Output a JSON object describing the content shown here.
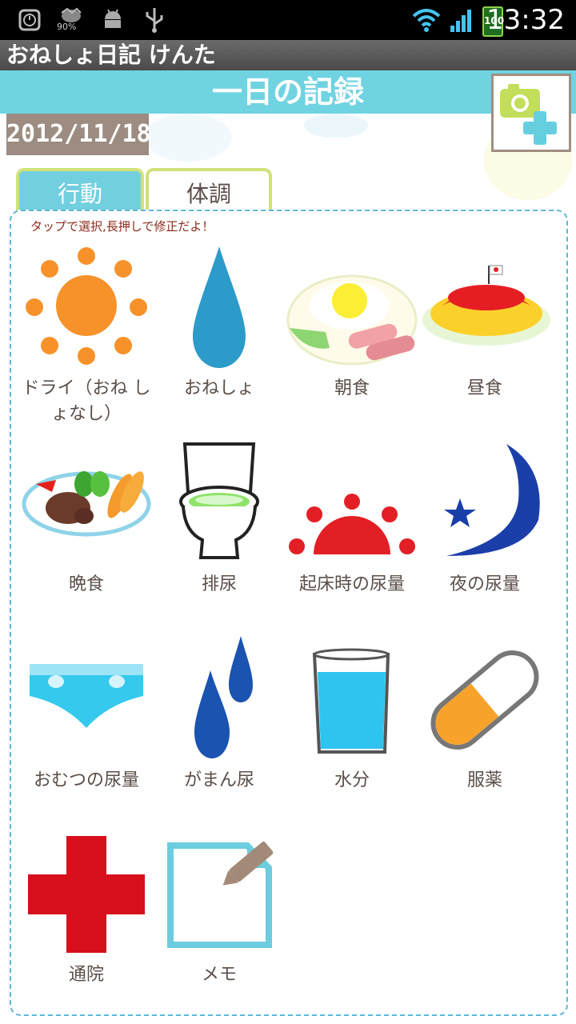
{
  "status_bar": {
    "battery_percent": "90%",
    "battery_level_label": "100",
    "time": "13:32"
  },
  "app": {
    "title": "おねしょ日記 けんた"
  },
  "header": {
    "title": "一日の記録"
  },
  "date": "2012/11/18",
  "tabs": [
    {
      "label": "行動",
      "selected": true
    },
    {
      "label": "体調",
      "selected": false
    }
  ],
  "hint": "タップで選択,長押しで修正だよ！",
  "items": [
    {
      "label": "ドライ（おね しょなし）",
      "icon": "sun-icon"
    },
    {
      "label": "おねしょ",
      "icon": "drop-icon"
    },
    {
      "label": "朝食",
      "icon": "breakfast-icon"
    },
    {
      "label": "昼食",
      "icon": "omurice-icon"
    },
    {
      "label": "晩食",
      "icon": "dinner-plate-icon"
    },
    {
      "label": "排尿",
      "icon": "toilet-icon"
    },
    {
      "label": "起床時の尿量",
      "icon": "rising-sun-icon"
    },
    {
      "label": "夜の尿量",
      "icon": "moon-icon"
    },
    {
      "label": "おむつの尿量",
      "icon": "diaper-icon"
    },
    {
      "label": "がまん尿",
      "icon": "two-drops-icon"
    },
    {
      "label": "水分",
      "icon": "water-glass-icon"
    },
    {
      "label": "服薬",
      "icon": "capsule-icon"
    },
    {
      "label": "通院",
      "icon": "red-cross-icon"
    },
    {
      "label": "メモ",
      "icon": "memo-icon"
    }
  ],
  "colors": {
    "header_accent": "#6fd3e1",
    "tab_border": "#cfe27a",
    "date_bg": "#9c8c81",
    "text": "#5a4e48"
  }
}
